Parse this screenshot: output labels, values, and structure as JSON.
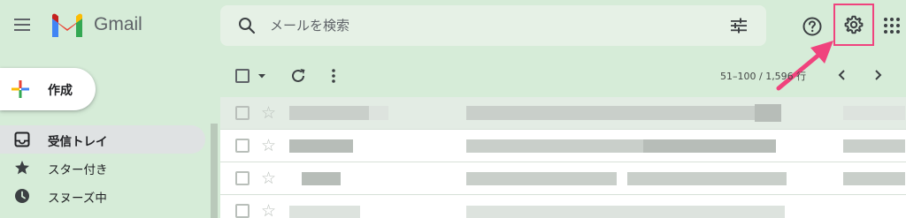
{
  "header": {
    "brand": "Gmail",
    "search_placeholder": "メールを検索"
  },
  "compose": {
    "label": "作成"
  },
  "sidebar": {
    "items": [
      {
        "label": "受信トレイ",
        "icon": "inbox-icon",
        "active": true
      },
      {
        "label": "スター付き",
        "icon": "star-icon",
        "active": false
      },
      {
        "label": "スヌーズ中",
        "icon": "clock-icon",
        "active": false
      }
    ]
  },
  "toolbar": {
    "pager": "51–100 / 1,596 行"
  },
  "annotation": {
    "highlight_color": "#f0437d"
  }
}
